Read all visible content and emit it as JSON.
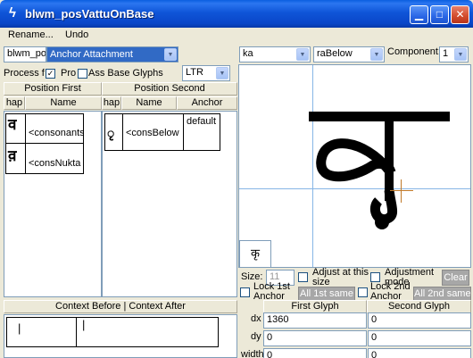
{
  "window": {
    "title": "blwm_posVattuOnBase",
    "icon_glyph": "ϟ",
    "minimize_glyph": "▁",
    "maximize_glyph": "□",
    "close_glyph": "✕"
  },
  "menu": [
    "Rename...",
    "Undo"
  ],
  "left": {
    "lookup_name": "blwm_pos",
    "lookup_type": "Anchor Attachment",
    "process_label": "Process f",
    "process_checked": "✓",
    "prop_label": "Pro",
    "pass_base_label": "Ass Base Glyphs",
    "direction": "LTR",
    "position_first": {
      "header": "Position First",
      "columns": [
        "hap",
        "Name"
      ],
      "rows": [
        {
          "glyph": "व",
          "name": "<consonants"
        },
        {
          "glyph": "व़",
          "name": "<consNukta"
        }
      ]
    },
    "position_second": {
      "header": "Position Second",
      "columns": [
        "hap",
        "Name",
        "Anchor"
      ],
      "rows": [
        {
          "glyph": "ृ",
          "name": "<consBelow",
          "anchor": "default"
        }
      ]
    },
    "context": {
      "header": "Context Before | Context After",
      "before": "|",
      "after": "|"
    }
  },
  "right": {
    "glyph1": "ka",
    "glyph2": "raBelow",
    "component_label": "Component:",
    "component_value": "1",
    "preview_glyph": "कृ",
    "small_preview_glyph": "कृ",
    "size_label": "Size:",
    "size_value": "11",
    "adjust_label": "Adjust at this size",
    "adjustment_mode_label": "Adjustment mode",
    "clear_label": "Clear",
    "lock_1st_label": "Lock 1st Anchor",
    "all_1st_same_label": "All 1st same",
    "lock_2nd_label": "Lock 2nd Anchor",
    "all_2nd_same_label": "All 2nd same",
    "table": {
      "col1": "First Glyph",
      "col2": "Second Glyph",
      "rows": [
        {
          "label": "dx",
          "first": "1360",
          "second": "0"
        },
        {
          "label": "dy",
          "first": "0",
          "second": "0"
        },
        {
          "label": "width",
          "first": "0",
          "second": "0"
        }
      ]
    }
  },
  "colors": {
    "title_bar": "#0a46c8",
    "crosshair": "#87b6e6",
    "anchor_mark": "#c07a2a"
  }
}
